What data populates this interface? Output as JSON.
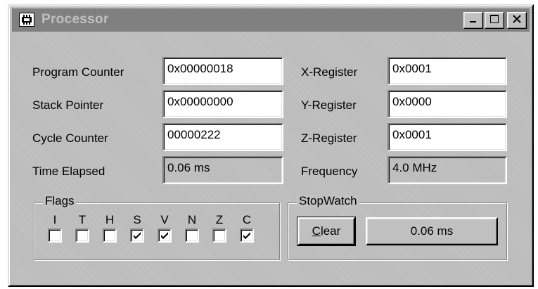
{
  "window": {
    "title": "Processor",
    "icon": "chip-icon",
    "controls": {
      "minimize": "minimize-icon",
      "maximize": "maximize-icon",
      "close": "close-icon"
    }
  },
  "registers": {
    "program_counter": {
      "label": "Program Counter",
      "value": "0x00000018"
    },
    "stack_pointer": {
      "label": "Stack Pointer",
      "value": "0x00000000"
    },
    "cycle_counter": {
      "label": "Cycle Counter",
      "value": "00000222"
    },
    "time_elapsed": {
      "label": "Time Elapsed",
      "value": "0.06 ms"
    },
    "x_register": {
      "label": "X-Register",
      "value": "0x0001"
    },
    "y_register": {
      "label": "Y-Register",
      "value": "0x0000"
    },
    "z_register": {
      "label": "Z-Register",
      "value": "0x0001"
    },
    "frequency": {
      "label": "Frequency",
      "value": "4.0 MHz"
    }
  },
  "flags": {
    "title": "Flags",
    "items": [
      {
        "letter": "I",
        "checked": false
      },
      {
        "letter": "T",
        "checked": false
      },
      {
        "letter": "H",
        "checked": false
      },
      {
        "letter": "S",
        "checked": true
      },
      {
        "letter": "V",
        "checked": true
      },
      {
        "letter": "N",
        "checked": false
      },
      {
        "letter": "Z",
        "checked": false
      },
      {
        "letter": "C",
        "checked": true
      }
    ]
  },
  "stopwatch": {
    "title": "StopWatch",
    "clear_label": "Clear",
    "display": "0.06 ms"
  }
}
